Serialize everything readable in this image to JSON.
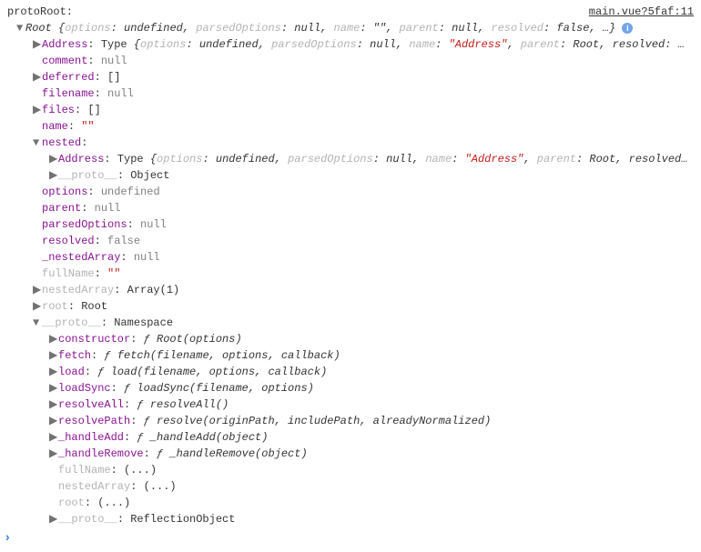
{
  "source": {
    "file": "main.vue?5faf",
    "line": "11"
  },
  "label": "protoRoot:",
  "root_summary": {
    "type": "Root",
    "options": "undefined",
    "parsedOptions": "null",
    "name": "\"\"",
    "parent": "null",
    "resolved": "false",
    "trail": ", …}"
  },
  "address_summary": {
    "key": "Address",
    "type": "Type",
    "options": "undefined",
    "parsedOptions": "null",
    "name": "\"Address\"",
    "parent": "Root",
    "post": ", resolved: …"
  },
  "fields": {
    "comment": {
      "key": "comment",
      "val": "null"
    },
    "deferred": {
      "key": "deferred",
      "val": "[]"
    },
    "filename": {
      "key": "filename",
      "val": "null"
    },
    "files": {
      "key": "files",
      "val": "[]"
    },
    "name": {
      "key": "name",
      "val": "\"\""
    },
    "options": {
      "key": "options",
      "val": "undefined"
    },
    "parent": {
      "key": "parent",
      "val": "null"
    },
    "parsedOptions": {
      "key": "parsedOptions",
      "val": "null"
    },
    "resolved": {
      "key": "resolved",
      "val": "false"
    },
    "nestedArrayNull": {
      "key": "_nestedArray",
      "val": "null"
    },
    "fullName": {
      "key": "fullName",
      "val": "\"\""
    },
    "nestedArray1": {
      "key": "nestedArray",
      "val": "Array(1)"
    },
    "rootRoot": {
      "key": "root",
      "val": "Root"
    },
    "proto_ns": {
      "key": "__proto__",
      "val": "Namespace"
    }
  },
  "nested": {
    "label": "nested",
    "address": {
      "key": "Address",
      "type": "Type",
      "options": "undefined",
      "parsedOptions": "null",
      "name": "\"Address\"",
      "parent": "Root",
      "post": ", resolved…"
    },
    "proto_obj": {
      "key": "__proto__",
      "val": "Object"
    }
  },
  "proto": {
    "constructor": {
      "key": "constructor",
      "sig": "Root(options)"
    },
    "fetch": {
      "key": "fetch",
      "sig": "fetch(filename, options, callback)"
    },
    "load": {
      "key": "load",
      "sig": "load(filename, options, callback)"
    },
    "loadSync": {
      "key": "loadSync",
      "sig": "loadSync(filename, options)"
    },
    "resolveAll": {
      "key": "resolveAll",
      "sig": "resolveAll()"
    },
    "resolvePath": {
      "key": "resolvePath",
      "sig": "resolve(originPath, includePath, alreadyNormalized)"
    },
    "_handleAdd": {
      "key": "_handleAdd",
      "sig": "_handleAdd(object)"
    },
    "_handleRemove": {
      "key": "_handleRemove",
      "sig": "_handleRemove(object)"
    },
    "fullNameEllipsis": {
      "key": "fullName",
      "val": "(...)"
    },
    "nestedArrayEllipsis": {
      "key": "nestedArray",
      "val": "(...)"
    },
    "rootEllipsis": {
      "key": "root",
      "val": "(...)"
    },
    "protoRefl": {
      "key": "__proto__",
      "val": "ReflectionObject"
    }
  },
  "f": "ƒ"
}
